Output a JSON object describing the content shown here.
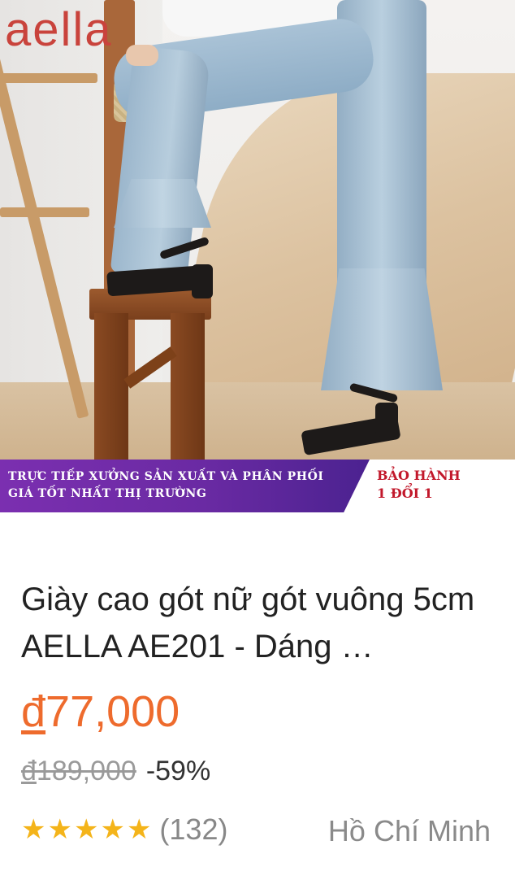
{
  "product": {
    "brand_logo": "aella",
    "banner": {
      "line1": "TRỰC TIẾP XƯỞNG SẢN XUẤT VÀ PHÂN PHỐI",
      "line2": "GIÁ TỐT NHẤT THỊ TRƯỜNG",
      "badge_line1": "BẢO HÀNH",
      "badge_line2": "1 ĐỔI 1"
    },
    "title": "Giày cao gót nữ gót vuông 5cm AELLA AE201 - Dáng …",
    "currency_symbol": "đ",
    "price": "77,000",
    "old_price": "189,000",
    "discount": "-59%",
    "rating": {
      "stars": 5,
      "count_text": "(132)"
    },
    "location": "Hồ Chí Minh"
  },
  "colors": {
    "price": "#ee6b2d",
    "star": "#f4b41a",
    "banner_purple": "#6a2aa3",
    "badge_red": "#c2182b",
    "logo": "#c9433c"
  },
  "icons": [
    "star-icon"
  ]
}
